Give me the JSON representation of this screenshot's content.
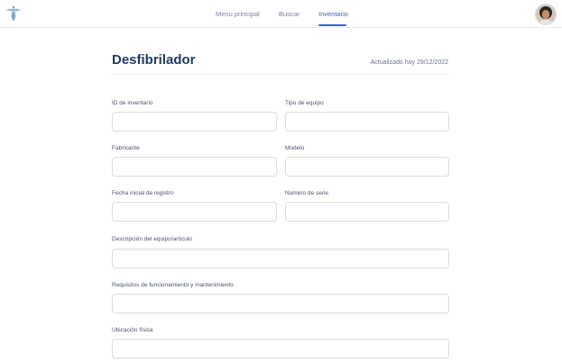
{
  "nav": {
    "items": [
      {
        "label": "Menu principal"
      },
      {
        "label": "Buscar"
      },
      {
        "label": "Inventario",
        "active": true
      }
    ]
  },
  "icons": {
    "logo": "caduceus-icon",
    "avatar": "user-avatar"
  },
  "colors": {
    "accent": "#3c69b5",
    "title": "#1f3b63",
    "field_border": "#d9dee7"
  },
  "page": {
    "title": "Desfibrilador",
    "updated": "Actualizado hoy  29/12/2022"
  },
  "form": {
    "inventory_id": {
      "label": "ID de inventario",
      "value": ""
    },
    "equipment_type": {
      "label": "Tipo de  equipo",
      "value": ""
    },
    "manufacturer": {
      "label": "Fabricante",
      "value": ""
    },
    "model": {
      "label": "Modelo",
      "value": ""
    },
    "start_date": {
      "label": "Fecha inicial de registro",
      "value": ""
    },
    "serial_number": {
      "label": "Numero de serie",
      "value": ""
    },
    "description": {
      "label": "Descripción del  equipo/artículo",
      "value": ""
    },
    "requirements": {
      "label": "Requisitos de funcionamiento y mantenimiento",
      "value": ""
    },
    "location": {
      "label": "Ubicación física",
      "value": ""
    }
  }
}
